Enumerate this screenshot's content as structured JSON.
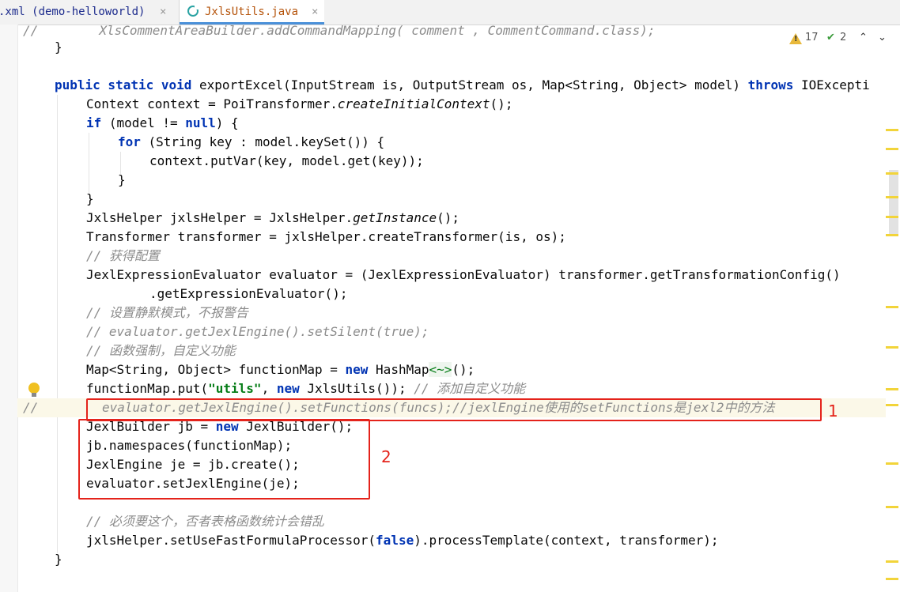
{
  "tabs": [
    {
      "label": ".xml (demo-helloworld)",
      "close": "×"
    },
    {
      "label": "JxlsUtils.java",
      "close": "×",
      "icon": "java-class-icon"
    }
  ],
  "inspection": {
    "warnings": "17",
    "typos": "2",
    "prev": "⌃",
    "next": "⌄"
  },
  "annotations": [
    {
      "label": "1"
    },
    {
      "label": "2"
    }
  ],
  "code": {
    "l0_prefix": "//",
    "l0_text": "        XlsCommentAreaBuilder.addCommandMapping( comment , CommentCommand.class);",
    "l1": "}",
    "l3a": "public static void ",
    "l3b": "exportExcel(InputStream is, OutputStream os, Map<String, Object> model) ",
    "l3c": "throws ",
    "l3d": "IOExcepti",
    "l4a": "Context context = PoiTransformer.",
    "l4b": "createInitialContext",
    "l4c": "();",
    "l5a": "if ",
    "l5b": "(model != ",
    "l5c": "null",
    "l5d": ") {",
    "l6a": "for ",
    "l6b": "(String key : model.keySet()) {",
    "l7": "context.putVar(key, model.get(key));",
    "l8": "}",
    "l9": "}",
    "l10a": "JxlsHelper jxlsHelper = JxlsHelper.",
    "l10b": "getInstance",
    "l10c": "();",
    "l11": "Transformer transformer = jxlsHelper.createTransformer(is, os);",
    "l12": "// 获得配置",
    "l13": "JexlExpressionEvaluator evaluator = (JexlExpressionEvaluator) transformer.getTransformationConfig()",
    "l14": ".getExpressionEvaluator();",
    "l15": "// 设置静默模式，不报警告",
    "l16": "// evaluator.getJexlEngine().setSilent(true);",
    "l17": "// 函数强制，自定义功能",
    "l18a": "Map<String, Object> functionMap = ",
    "l18b": "new ",
    "l18c": "HashMap",
    "l18d": "<~>",
    "l18e": "();",
    "l19a": "functionMap.put(",
    "l19b": "\"utils\"",
    "l19c": ", ",
    "l19d": "new ",
    "l19e": "JxlsUtils()); ",
    "l19f": "// 添加自定义功能",
    "l20_prefix": "//",
    "l20": "evaluator.getJexlEngine().setFunctions(funcs);//jexlEngine使用的setFunctions是jexl2中的方法",
    "l21a": "JexlBuilder jb = ",
    "l21b": "new ",
    "l21c": "JexlBuilder();",
    "l22": "jb.namespaces(functionMap);",
    "l23": "JexlEngine je = jb.create();",
    "l24": "evaluator.setJexlEngine(je);",
    "l26": "// 必须要这个，否者表格函数统计会错乱",
    "l27a": "jxlsHelper.setUseFastFormulaProcessor(",
    "l27b": "false",
    "l27c": ").processTemplate(context, transformer);",
    "l28": "}"
  },
  "colors": {
    "accent": "#4a90d9",
    "annotation": "#e4231b",
    "keyword": "#0033b3",
    "comment": "#8c8c8c",
    "string": "#067d17"
  }
}
